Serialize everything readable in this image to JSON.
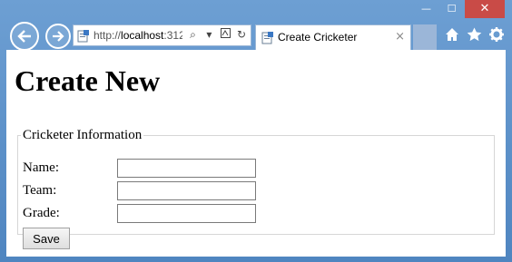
{
  "window": {
    "minimize_glyph": "—",
    "maximize_glyph": "☐",
    "close_glyph": "✕"
  },
  "address_bar": {
    "url_prefix": "http://",
    "url_host": "localhost",
    "url_rest": ":312",
    "search_glyph": "⌕",
    "dropdown_glyph": "▾",
    "refresh_glyph": "↻"
  },
  "tab": {
    "title": "Create Cricketer",
    "close_glyph": "×"
  },
  "page": {
    "heading": "Create New",
    "legend": "Cricketer Information",
    "fields": [
      {
        "label": "Name:",
        "value": ""
      },
      {
        "label": "Team:",
        "value": ""
      },
      {
        "label": "Grade:",
        "value": ""
      }
    ],
    "save_label": "Save"
  }
}
